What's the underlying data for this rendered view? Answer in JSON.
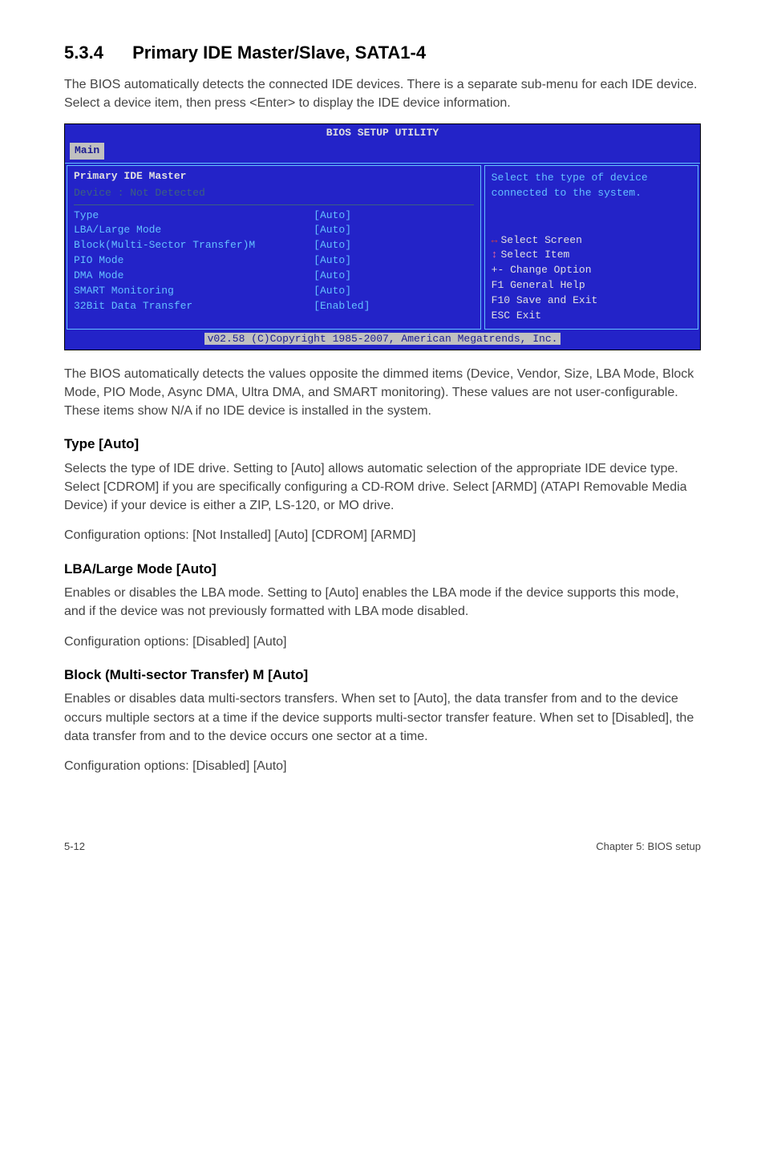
{
  "section": {
    "number": "5.3.4",
    "title": "Primary IDE Master/Slave, SATA1-4"
  },
  "intro": "The BIOS automatically detects the connected IDE devices. There is a separate sub-menu for each IDE device. Select a device item, then press <Enter> to display the IDE device information.",
  "bios": {
    "title": "BIOS SETUP UTILITY",
    "tab": "Main",
    "header": "Primary IDE Master",
    "device_row": "Device          : Not Detected",
    "items": [
      {
        "label": "Type",
        "value": "[Auto]"
      },
      {
        "label": "LBA/Large Mode",
        "value": "[Auto]"
      },
      {
        "label": "Block(Multi-Sector Transfer)M",
        "value": "[Auto]"
      },
      {
        "label": "PIO Mode",
        "value": "[Auto]"
      },
      {
        "label": "DMA Mode",
        "value": "[Auto]"
      },
      {
        "label": "SMART Monitoring",
        "value": "[Auto]"
      },
      {
        "label": "32Bit Data Transfer",
        "value": "[Enabled]"
      }
    ],
    "help_top": "Select the type of device connected to the system.",
    "help_bottom": {
      "l1a": "Select Screen",
      "l2a": "Select Item",
      "l3": "+-  Change Option",
      "l4": "F1  General Help",
      "l5": "F10 Save and Exit",
      "l6": "ESC Exit"
    },
    "footer": "v02.58 (C)Copyright 1985-2007, American Megatrends, Inc."
  },
  "after_bios": "The BIOS automatically detects the values opposite the dimmed items (Device, Vendor, Size, LBA Mode, Block Mode, PIO Mode, Async DMA, Ultra DMA, and SMART monitoring). These values are not user-configurable. These items show N/A if no IDE device is installed in the system.",
  "type_h": "Type [Auto]",
  "type_p1": "Selects the type of IDE drive. Setting to [Auto] allows automatic selection of the appropriate IDE device type. Select [CDROM] if you are specifically configuring a CD-ROM drive. Select [ARMD] (ATAPI Removable Media Device) if your device is either a ZIP, LS-120, or MO drive.",
  "type_p2": "Configuration options: [Not Installed] [Auto] [CDROM] [ARMD]",
  "lba_h": "LBA/Large Mode [Auto]",
  "lba_p1": "Enables or disables the LBA mode. Setting to [Auto] enables the LBA mode if the device supports this mode, and if the device was not previously formatted with LBA mode disabled.",
  "lba_p2": "Configuration options: [Disabled] [Auto]",
  "block_h": "Block (Multi-sector Transfer) M [Auto]",
  "block_p1": "Enables or disables data multi-sectors transfers. When set to [Auto], the data transfer from and to the device occurs multiple sectors at a time if the device supports multi-sector transfer feature. When set to [Disabled], the data transfer from and to the device occurs one sector at a time.",
  "block_p2": "Configuration options: [Disabled] [Auto]",
  "footer_left": "5-12",
  "footer_right": "Chapter 5: BIOS setup"
}
